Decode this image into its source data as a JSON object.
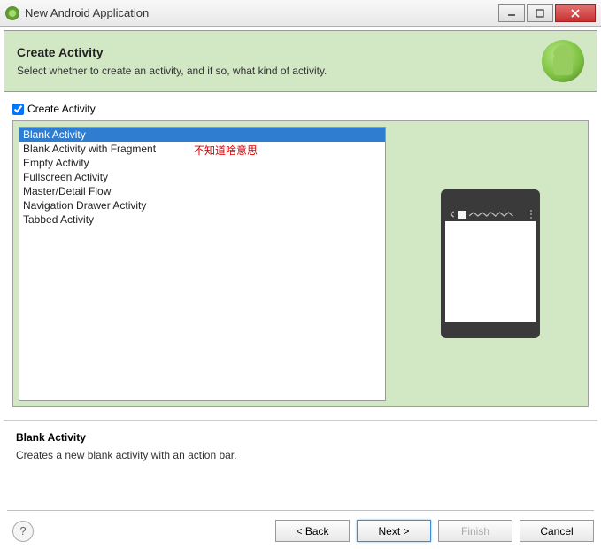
{
  "window": {
    "title": "New Android Application"
  },
  "banner": {
    "heading": "Create Activity",
    "subtext": "Select whether to create an activity, and if so, what kind of activity."
  },
  "checkbox": {
    "label": "Create Activity",
    "checked": true
  },
  "activities": [
    "Blank Activity",
    "Blank Activity with Fragment",
    "Empty Activity",
    "Fullscreen Activity",
    "Master/Detail Flow",
    "Navigation Drawer Activity",
    "Tabbed Activity"
  ],
  "selected_index": 0,
  "annotation": "不知道啥意思",
  "description": {
    "title": "Blank Activity",
    "text": "Creates a new blank activity with an action bar."
  },
  "buttons": {
    "back": "< Back",
    "next": "Next >",
    "finish": "Finish",
    "cancel": "Cancel"
  }
}
